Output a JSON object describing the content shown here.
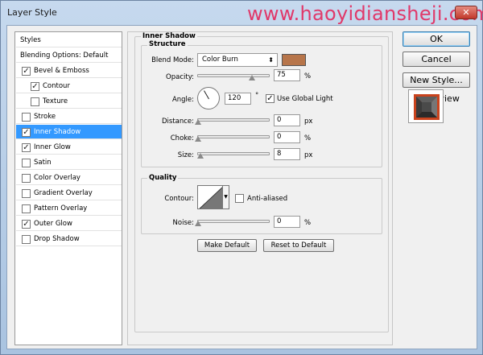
{
  "window": {
    "title": "Layer Style",
    "watermark": "www.haoyidiansheji.com",
    "close_label": "✕"
  },
  "sidebar": {
    "items": [
      {
        "label": "Styles",
        "type": "header"
      },
      {
        "label": "Blending Options: Default",
        "type": "header"
      },
      {
        "label": "Bevel & Emboss",
        "checked": true,
        "indent": 0
      },
      {
        "label": "Contour",
        "checked": true,
        "indent": 1
      },
      {
        "label": "Texture",
        "checked": false,
        "indent": 1
      },
      {
        "label": "Stroke",
        "checked": false,
        "indent": 0
      },
      {
        "label": "Inner Shadow",
        "checked": true,
        "indent": 0,
        "selected": true
      },
      {
        "label": "Inner Glow",
        "checked": true,
        "indent": 0
      },
      {
        "label": "Satin",
        "checked": false,
        "indent": 0
      },
      {
        "label": "Color Overlay",
        "checked": false,
        "indent": 0
      },
      {
        "label": "Gradient Overlay",
        "checked": false,
        "indent": 0
      },
      {
        "label": "Pattern Overlay",
        "checked": false,
        "indent": 0
      },
      {
        "label": "Outer Glow",
        "checked": true,
        "indent": 0
      },
      {
        "label": "Drop Shadow",
        "checked": false,
        "indent": 0
      }
    ],
    "check_mark": "✓"
  },
  "main": {
    "section_title": "Inner Shadow",
    "structure": {
      "title": "Structure",
      "blend_mode_label": "Blend Mode:",
      "blend_mode_value": "Color Burn",
      "blend_color": "#b7754a",
      "opacity_label": "Opacity:",
      "opacity_value": "75",
      "opacity_level": 0.75,
      "percent": "%",
      "angle_label": "Angle:",
      "angle_value": "120",
      "degree": "°",
      "global_light_label": "Use Global Light",
      "global_light_checked": true,
      "distance_label": "Distance:",
      "distance_value": "0",
      "px": "px",
      "choke_label": "Choke:",
      "choke_value": "0",
      "size_label": "Size:",
      "size_value": "8",
      "size_level": 0.04
    },
    "quality": {
      "title": "Quality",
      "contour_label": "Contour:",
      "anti_aliased_label": "Anti-aliased",
      "anti_aliased_checked": false,
      "noise_label": "Noise:",
      "noise_value": "0"
    },
    "buttons": {
      "make_default": "Make Default",
      "reset_default": "Reset to Default"
    }
  },
  "actions": {
    "ok": "OK",
    "cancel": "Cancel",
    "new_style": "New Style...",
    "preview_label": "Preview",
    "preview_checked": true
  }
}
